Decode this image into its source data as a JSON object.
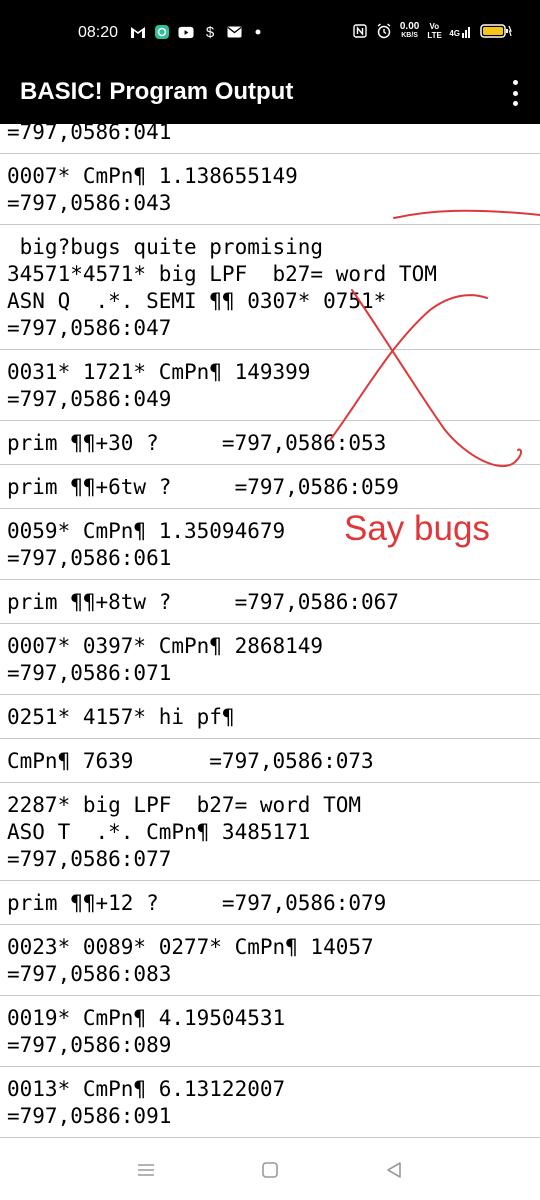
{
  "status_bar": {
    "time": "08:20",
    "left_icons": [
      "gmail-icon",
      "app-icon",
      "youtube-icon",
      "dollar-icon",
      "mail-icon",
      "dot-icon"
    ],
    "right_icons": [
      "nfc-icon",
      "alarm-icon",
      "network-speed-icon",
      "volte-icon",
      "4g-icon",
      "battery-icon"
    ],
    "net_speed_value": "0.00",
    "net_speed_unit": "KB/S",
    "volte": "Vo LTE",
    "signal": "4G"
  },
  "app_bar": {
    "title": "BASIC! Program Output",
    "menu_icon": "more-vert-icon"
  },
  "output_rows": [
    {
      "lines": [
        "=797,0586:041"
      ]
    },
    {
      "lines": [
        "0007* CmPn¶ 1.138655149",
        "=797,0586:043"
      ]
    },
    {
      "lines": [
        " big?bugs quite promising",
        "34571*4571* big LPF  b27= word TOM",
        "ASN Q  .*. SEMI ¶¶ 0307* 0751*",
        "=797,0586:047"
      ]
    },
    {
      "lines": [
        "0031* 1721* CmPn¶ 149399",
        "=797,0586:049"
      ]
    },
    {
      "lines": [
        "prim ¶¶+30 ?     =797,0586:053"
      ]
    },
    {
      "lines": [
        "prim ¶¶+6tw ?     =797,0586:059"
      ]
    },
    {
      "lines": [
        "0059* CmPn¶ 1.35094679",
        "=797,0586:061"
      ]
    },
    {
      "lines": [
        "prim ¶¶+8tw ?     =797,0586:067"
      ]
    },
    {
      "lines": [
        "0007* 0397* CmPn¶ 2868149",
        "=797,0586:071"
      ]
    },
    {
      "lines": [
        "0251* 4157* hi pf¶"
      ]
    },
    {
      "lines": [
        "CmPn¶ 7639      =797,0586:073"
      ]
    },
    {
      "lines": [
        "2287* big LPF  b27= word TOM",
        "ASO T  .*. CmPn¶ 3485171",
        "=797,0586:077"
      ]
    },
    {
      "lines": [
        "prim ¶¶+12 ?     =797,0586:079"
      ]
    },
    {
      "lines": [
        "0023* 0089* 0277* CmPn¶ 14057",
        "=797,0586:083"
      ]
    },
    {
      "lines": [
        "0019* CmPn¶ 4.19504531",
        "=797,0586:089"
      ]
    },
    {
      "lines": [
        "0013* CmPn¶ 6.13122007",
        "=797,0586:091"
      ]
    }
  ],
  "annotation": {
    "text": "Say bugs",
    "color": "#e0383a"
  },
  "nav_bar": {
    "buttons": [
      "menu-icon",
      "home-icon",
      "back-icon"
    ]
  }
}
